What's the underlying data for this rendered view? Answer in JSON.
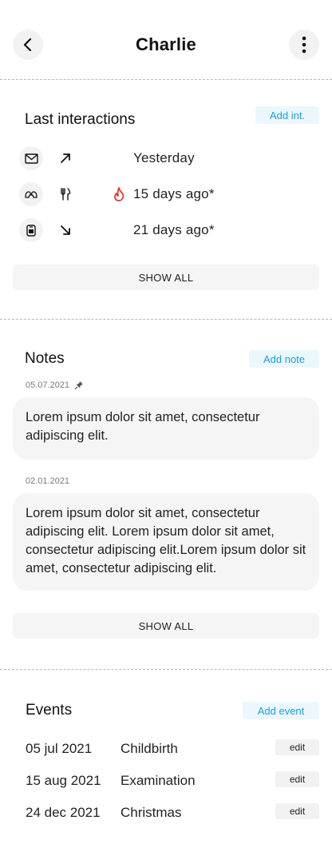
{
  "header": {
    "title": "Charlie",
    "back_icon": "chevron-left-icon",
    "menu_icon": "vertical-dots-icon"
  },
  "interactions": {
    "title": "Last interactions",
    "add_label": "Add int.",
    "items": [
      {
        "type_icon": "envelope-icon",
        "direction_icon": "arrow-up-right-icon",
        "flag_icon": "",
        "text": "Yesterday"
      },
      {
        "type_icon": "meeting-icon",
        "direction_icon": "fork-knife-icon",
        "flag_icon": "fire-icon",
        "text": "15 days ago*"
      },
      {
        "type_icon": "phone-icon",
        "direction_icon": "arrow-down-right-icon",
        "flag_icon": "",
        "text": "21 days ago*"
      }
    ],
    "show_all": "SHOW ALL"
  },
  "notes": {
    "title": "Notes",
    "add_label": "Add note",
    "items": [
      {
        "date": "05.07.2021",
        "pinned": true,
        "text": "Lorem ipsum dolor sit amet, consectetur adipiscing elit."
      },
      {
        "date": "02.01.2021",
        "pinned": false,
        "text": "Lorem ipsum dolor sit amet, consectetur adipiscing elit. Lorem ipsum dolor sit amet, consectetur adipiscing elit.Lorem ipsum dolor sit amet, consectetur adipiscing elit."
      }
    ],
    "show_all": "SHOW ALL"
  },
  "events": {
    "title": "Events",
    "add_label": "Add event",
    "edit_label": "edit",
    "items": [
      {
        "date": "05 jul 2021",
        "name": "Childbirth"
      },
      {
        "date": "15 aug 2021",
        "name": "Examination"
      },
      {
        "date": "24 dec 2021",
        "name": "Christmas"
      }
    ]
  },
  "colors": {
    "accent": "#1aa0e0",
    "accent_bg": "#ecf7fd",
    "fire": "#e8322b",
    "card_bg": "#f5f5f5"
  }
}
